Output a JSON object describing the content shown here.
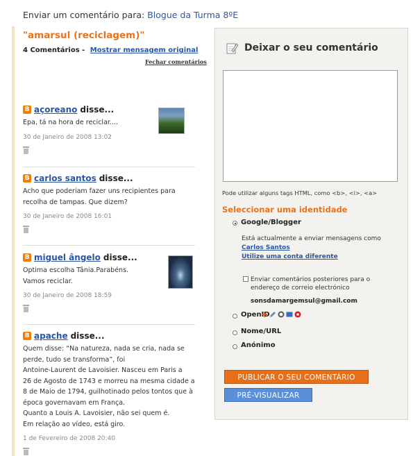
{
  "header": {
    "prefix": "Enviar um comentário para:",
    "blog_name": "Blogue da Turma 8ºE"
  },
  "post": {
    "title": "\"amarsul (reciclagem)\"",
    "count": "4 Comentários -",
    "show_original": "Mostrar mensagem original",
    "close_comments": "Fechar comentários"
  },
  "comments": [
    {
      "author": "açoreano",
      "said": "disse...",
      "body": [
        "Epa, tá na hora de reciclar...."
      ],
      "date": "30 de Janeiro de 2008 13:02"
    },
    {
      "author": "carlos santos",
      "said": "disse...",
      "body": [
        "Acho que poderiam fazer uns recipientes para",
        "recolha de tampas. Que dizem?"
      ],
      "date": "30 de Janeiro de 2008 16:01"
    },
    {
      "author": "miguel ângelo",
      "said": "disse...",
      "body": [
        "Optima escolha Tânia.Parabéns.",
        "Vamos reciclar."
      ],
      "date": "30 de Janeiro de 2008 18:59"
    },
    {
      "author": "apache",
      "said": "disse...",
      "body": [
        "Quem disse: “Na natureza, nada se cria, nada se",
        "perde, tudo se transforma”, foi",
        "Antoine-Laurent de Lavoisier. Nasceu em Paris a",
        "26 de Agosto de 1743 e morreu na mesma cidade a",
        "8 de Maio de 1794, guilhotinado pelos tontos que à",
        "época governavam em França.",
        "Quanto a Louis A. Lavoisier, não sei quem é.",
        "Em relação ao vídeo, está giro."
      ],
      "date": "1 de Fevereiro de 2008 20:40"
    }
  ],
  "form": {
    "title": "Deixar o seu comentário",
    "html_note": "Pode utilizar alguns tags HTML, como <b>, <i>, <a>",
    "identity_title": "Seleccionar uma identidade",
    "google_label": "Google/Blogger",
    "logged_in_text": "Está actualmente a enviar mensagens como",
    "user_name": "Carlos Santos",
    "other_account": "Utilize uma conta diferente",
    "email_followup": [
      "Enviar comentários posteriores para o",
      "endereço de correio electrónico"
    ],
    "email": "sonsdamargemsul@gmail.com",
    "openid_label": "OpenID",
    "name_url_label": "Nome/URL",
    "anonymous_label": "Anónimo",
    "publish_button": "PUBLICAR O SEU COMENTÁRIO",
    "preview_button": "PRÉ-VISUALIZAR"
  },
  "colors": {
    "accent_orange": "#e8731c",
    "link_blue": "#2a56a8",
    "preview_blue": "#5b8fd8"
  }
}
